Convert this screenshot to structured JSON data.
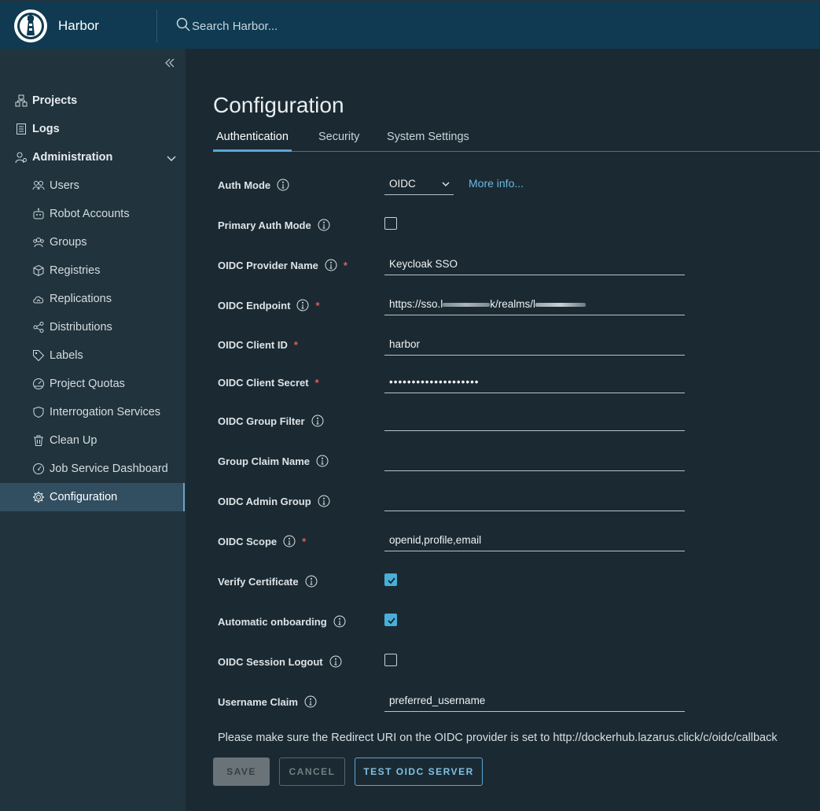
{
  "header": {
    "app_name": "Harbor",
    "search_placeholder": "Search Harbor..."
  },
  "sidebar": {
    "items": [
      {
        "label": "Projects",
        "icon": "projects-icon"
      },
      {
        "label": "Logs",
        "icon": "logs-icon"
      },
      {
        "label": "Administration",
        "icon": "administration-icon"
      }
    ],
    "admin_items": [
      {
        "label": "Users"
      },
      {
        "label": "Robot Accounts"
      },
      {
        "label": "Groups"
      },
      {
        "label": "Registries"
      },
      {
        "label": "Replications"
      },
      {
        "label": "Distributions"
      },
      {
        "label": "Labels"
      },
      {
        "label": "Project Quotas"
      },
      {
        "label": "Interrogation Services"
      },
      {
        "label": "Clean Up"
      },
      {
        "label": "Job Service Dashboard"
      },
      {
        "label": "Configuration"
      }
    ]
  },
  "main": {
    "title": "Configuration",
    "tabs": [
      {
        "label": "Authentication",
        "active": true
      },
      {
        "label": "Security",
        "active": false
      },
      {
        "label": "System Settings",
        "active": false
      }
    ],
    "form": {
      "auth_mode": {
        "label": "Auth Mode",
        "value": "OIDC",
        "more_info": "More info..."
      },
      "primary_auth_mode": {
        "label": "Primary Auth Mode",
        "checked": false
      },
      "oidc_provider_name": {
        "label": "OIDC Provider Name",
        "value": "Keycloak SSO"
      },
      "oidc_endpoint": {
        "label": "OIDC Endpoint",
        "value_prefix": "https://sso.l",
        "value_mid": "k/realms/l"
      },
      "oidc_client_id": {
        "label": "OIDC Client ID",
        "value": "harbor"
      },
      "oidc_client_secret": {
        "label": "OIDC Client Secret",
        "value": "••••••••••••••••••••"
      },
      "oidc_group_filter": {
        "label": "OIDC Group Filter",
        "value": ""
      },
      "group_claim_name": {
        "label": "Group Claim Name",
        "value": ""
      },
      "oidc_admin_group": {
        "label": "OIDC Admin Group",
        "value": ""
      },
      "oidc_scope": {
        "label": "OIDC Scope",
        "value": "openid,profile,email"
      },
      "verify_certificate": {
        "label": "Verify Certificate",
        "checked": true
      },
      "automatic_onboarding": {
        "label": "Automatic onboarding",
        "checked": true
      },
      "oidc_session_logout": {
        "label": "OIDC Session Logout",
        "checked": false
      },
      "username_claim": {
        "label": "Username Claim",
        "value": "preferred_username"
      }
    },
    "redirect_note": "Please make sure the Redirect URI on the OIDC provider is set to http://dockerhub.lazarus.click/c/oidc/callback",
    "buttons": {
      "save": "SAVE",
      "cancel": "CANCEL",
      "test": "TEST OIDC SERVER"
    }
  },
  "colors": {
    "header_bg": "#0f3a52",
    "sidebar_bg": "#21333c",
    "main_bg": "#1b2a32",
    "accent": "#57a7d6",
    "link": "#6cb8e2",
    "required": "#e05d5d"
  }
}
